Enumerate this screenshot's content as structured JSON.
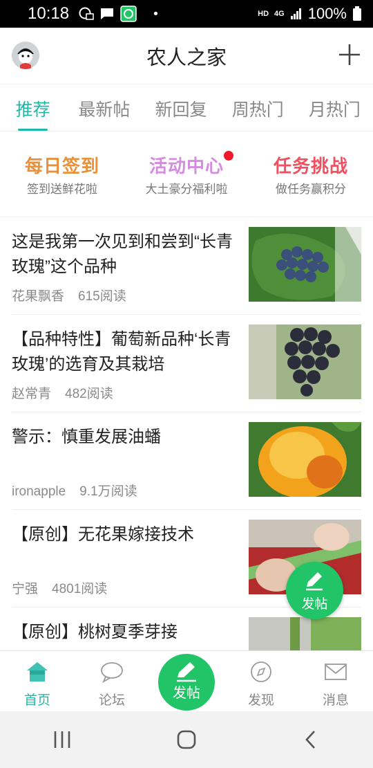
{
  "status_bar": {
    "time": "10:18",
    "network": "HD",
    "signal_type": "4G",
    "battery": "100%"
  },
  "header": {
    "title": "农人之家",
    "add_icon": "plus-icon"
  },
  "tabs": [
    {
      "label": "推荐",
      "active": true
    },
    {
      "label": "最新帖",
      "active": false
    },
    {
      "label": "新回复",
      "active": false
    },
    {
      "label": "周热门",
      "active": false
    },
    {
      "label": "月热门",
      "active": false
    }
  ],
  "quick_entries": [
    {
      "title": "每日签到",
      "subtitle": "签到送鲜花啦",
      "color": "#e8903a"
    },
    {
      "title": "活动中心",
      "subtitle": "大土豪分福利啦",
      "color": "#d58be0",
      "badge_dot": true
    },
    {
      "title": "任务挑战",
      "subtitle": "做任务赢积分",
      "color": "#f05060"
    }
  ],
  "posts": [
    {
      "title": "这是我第一次见到和尝到“长青玫瑰”这个品种",
      "author": "花果飘香",
      "reads": "615阅读",
      "thumb": "grapes-on-leaf"
    },
    {
      "title": "【品种特性】葡萄新品种‘长青玫瑰’的选育及其栽培",
      "author": "赵常青",
      "reads": "482阅读",
      "thumb": "grape-bunch"
    },
    {
      "title": "警示：慎重发展油蟠",
      "author": "ironapple",
      "reads": "9.1万阅读",
      "thumb": "peach"
    },
    {
      "title": "【原创】无花果嫁接技术",
      "author": "宁强",
      "reads": "4801阅读",
      "thumb": "grafting"
    },
    {
      "title": "【原创】桃树夏季芽接",
      "author": "",
      "reads": "",
      "thumb": "bud-graft"
    }
  ],
  "fab": {
    "label": "发帖",
    "icon": "pencil-icon"
  },
  "bottom_nav": [
    {
      "label": "首页",
      "icon": "home-icon",
      "active": true
    },
    {
      "label": "论坛",
      "icon": "chat-icon",
      "active": false
    },
    {
      "label": "发帖",
      "icon": "pencil-icon",
      "center": true
    },
    {
      "label": "发现",
      "icon": "compass-icon",
      "active": false
    },
    {
      "label": "消息",
      "icon": "mail-icon",
      "active": false
    }
  ],
  "colors": {
    "accent": "#1fb8a8",
    "green": "#22c468",
    "red_dot": "#f0192c"
  }
}
